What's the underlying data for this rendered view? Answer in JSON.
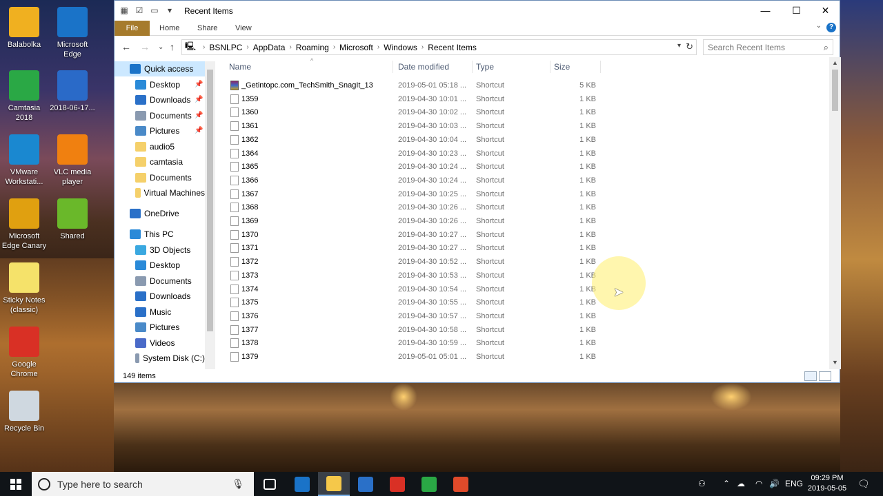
{
  "desktop": {
    "icons": [
      {
        "label": "Balabolka",
        "icon": "balabolka-icon",
        "color": "#f0b020"
      },
      {
        "label": "Microsoft Edge",
        "icon": "edge-icon",
        "color": "#1a73c8"
      },
      {
        "label": "Camtasia 2018",
        "icon": "camtasia-icon",
        "color": "#2aa845"
      },
      {
        "label": "2018-06-17...",
        "icon": "screenshot-file-icon",
        "color": "#2a6ac8"
      },
      {
        "label": "VMware Workstati...",
        "icon": "vmware-icon",
        "color": "#1a88d0"
      },
      {
        "label": "VLC media player",
        "icon": "vlc-icon",
        "color": "#f08010"
      },
      {
        "label": "Microsoft Edge Canary",
        "icon": "edge-canary-icon",
        "color": "#e0a010"
      },
      {
        "label": "Shared",
        "icon": "folder-icon",
        "color": "#6ab82a"
      },
      {
        "label": "Sticky Notes (classic)",
        "icon": "sticky-notes-icon",
        "color": "#f5e26a"
      },
      {
        "label": "Google Chrome",
        "icon": "chrome-icon",
        "color": "#d93025"
      },
      {
        "label": "Recycle Bin",
        "icon": "recycle-bin-icon",
        "color": "#cfd8e0"
      }
    ]
  },
  "window": {
    "title": "Recent Items",
    "ribbon_tabs": [
      "File",
      "Home",
      "Share",
      "View"
    ],
    "breadcrumb": [
      "BSNLPC",
      "AppData",
      "Roaming",
      "Microsoft",
      "Windows",
      "Recent Items"
    ],
    "search_placeholder": "Search Recent Items",
    "columns": [
      "Name",
      "Date modified",
      "Type",
      "Size"
    ],
    "status": "149 items",
    "nav": [
      {
        "label": "Quick access",
        "icon": "star-icon",
        "color": "#1a73c8",
        "level": 0,
        "selected": true
      },
      {
        "label": "Desktop",
        "icon": "desktop-icon",
        "color": "#2a8ad8",
        "level": 1,
        "pinned": true
      },
      {
        "label": "Downloads",
        "icon": "download-arrow-icon",
        "color": "#2a70c8",
        "level": 1,
        "pinned": true
      },
      {
        "label": "Documents",
        "icon": "documents-icon",
        "color": "#8a9ab0",
        "level": 1,
        "pinned": true
      },
      {
        "label": "Pictures",
        "icon": "pictures-icon",
        "color": "#4a8ac8",
        "level": 1,
        "pinned": true
      },
      {
        "label": "audio5",
        "icon": "folder-icon",
        "color": "#f5d06a",
        "level": 1
      },
      {
        "label": "camtasia",
        "icon": "folder-icon",
        "color": "#f5d06a",
        "level": 1
      },
      {
        "label": "Documents",
        "icon": "synced-folder-icon",
        "color": "#f5d06a",
        "level": 1
      },
      {
        "label": "Virtual Machines",
        "icon": "folder-icon",
        "color": "#f5d06a",
        "level": 1
      },
      {
        "label": "OneDrive",
        "icon": "onedrive-icon",
        "color": "#2a70c8",
        "level": 0
      },
      {
        "label": "This PC",
        "icon": "this-pc-icon",
        "color": "#2a8ad8",
        "level": 0
      },
      {
        "label": "3D Objects",
        "icon": "3d-objects-icon",
        "color": "#3aa8e0",
        "level": 1
      },
      {
        "label": "Desktop",
        "icon": "desktop-icon",
        "color": "#2a8ad8",
        "level": 1
      },
      {
        "label": "Documents",
        "icon": "documents-icon",
        "color": "#8a9ab0",
        "level": 1
      },
      {
        "label": "Downloads",
        "icon": "download-arrow-icon",
        "color": "#2a70c8",
        "level": 1
      },
      {
        "label": "Music",
        "icon": "music-icon",
        "color": "#2a70c8",
        "level": 1
      },
      {
        "label": "Pictures",
        "icon": "pictures-icon",
        "color": "#4a8ac8",
        "level": 1
      },
      {
        "label": "Videos",
        "icon": "videos-icon",
        "color": "#4a6ac8",
        "level": 1
      },
      {
        "label": "System Disk (C:)",
        "icon": "drive-icon",
        "color": "#8a9ab0",
        "level": 1
      }
    ],
    "files": [
      {
        "name": "_Getintopc.com_TechSmith_SnagIt_13",
        "date": "2019-05-01 05:18 ...",
        "type": "Shortcut",
        "size": "5 KB",
        "icon": "winrar-shortcut-icon"
      },
      {
        "name": "1359",
        "date": "2019-04-30 10:01 ...",
        "type": "Shortcut",
        "size": "1 KB",
        "icon": "blank-file-icon"
      },
      {
        "name": "1360",
        "date": "2019-04-30 10:02 ...",
        "type": "Shortcut",
        "size": "1 KB",
        "icon": "blank-file-icon"
      },
      {
        "name": "1361",
        "date": "2019-04-30 10:03 ...",
        "type": "Shortcut",
        "size": "1 KB",
        "icon": "blank-file-icon"
      },
      {
        "name": "1362",
        "date": "2019-04-30 10:04 ...",
        "type": "Shortcut",
        "size": "1 KB",
        "icon": "blank-file-icon"
      },
      {
        "name": "1364",
        "date": "2019-04-30 10:23 ...",
        "type": "Shortcut",
        "size": "1 KB",
        "icon": "blank-file-icon"
      },
      {
        "name": "1365",
        "date": "2019-04-30 10:24 ...",
        "type": "Shortcut",
        "size": "1 KB",
        "icon": "blank-file-icon"
      },
      {
        "name": "1366",
        "date": "2019-04-30 10:24 ...",
        "type": "Shortcut",
        "size": "1 KB",
        "icon": "blank-file-icon"
      },
      {
        "name": "1367",
        "date": "2019-04-30 10:25 ...",
        "type": "Shortcut",
        "size": "1 KB",
        "icon": "blank-file-icon"
      },
      {
        "name": "1368",
        "date": "2019-04-30 10:26 ...",
        "type": "Shortcut",
        "size": "1 KB",
        "icon": "blank-file-icon"
      },
      {
        "name": "1369",
        "date": "2019-04-30 10:26 ...",
        "type": "Shortcut",
        "size": "1 KB",
        "icon": "blank-file-icon"
      },
      {
        "name": "1370",
        "date": "2019-04-30 10:27 ...",
        "type": "Shortcut",
        "size": "1 KB",
        "icon": "blank-file-icon"
      },
      {
        "name": "1371",
        "date": "2019-04-30 10:27 ...",
        "type": "Shortcut",
        "size": "1 KB",
        "icon": "blank-file-icon"
      },
      {
        "name": "1372",
        "date": "2019-04-30 10:52 ...",
        "type": "Shortcut",
        "size": "1 KB",
        "icon": "blank-file-icon"
      },
      {
        "name": "1373",
        "date": "2019-04-30 10:53 ...",
        "type": "Shortcut",
        "size": "1 KB",
        "icon": "blank-file-icon"
      },
      {
        "name": "1374",
        "date": "2019-04-30 10:54 ...",
        "type": "Shortcut",
        "size": "1 KB",
        "icon": "blank-file-icon"
      },
      {
        "name": "1375",
        "date": "2019-04-30 10:55 ...",
        "type": "Shortcut",
        "size": "1 KB",
        "icon": "blank-file-icon"
      },
      {
        "name": "1376",
        "date": "2019-04-30 10:57 ...",
        "type": "Shortcut",
        "size": "1 KB",
        "icon": "blank-file-icon"
      },
      {
        "name": "1377",
        "date": "2019-04-30 10:58 ...",
        "type": "Shortcut",
        "size": "1 KB",
        "icon": "blank-file-icon"
      },
      {
        "name": "1378",
        "date": "2019-04-30 10:59 ...",
        "type": "Shortcut",
        "size": "1 KB",
        "icon": "blank-file-icon"
      },
      {
        "name": "1379",
        "date": "2019-05-01 05:01 ...",
        "type": "Shortcut",
        "size": "1 KB",
        "icon": "blank-file-icon"
      }
    ]
  },
  "taskbar": {
    "search_placeholder": "Type here to search",
    "apps": [
      {
        "icon": "task-view-icon",
        "color": "#ffffff"
      },
      {
        "icon": "edge-icon",
        "color": "#1a73c8"
      },
      {
        "icon": "file-explorer-icon",
        "color": "#f5c84a",
        "active": true
      },
      {
        "icon": "store-icon",
        "color": "#2a70c8"
      },
      {
        "icon": "chrome-icon",
        "color": "#d93025"
      },
      {
        "icon": "camtasia-icon",
        "color": "#2aa845"
      },
      {
        "icon": "snagit-icon",
        "color": "#e04a2a"
      }
    ],
    "language": "ENG",
    "time": "09:29 PM",
    "date": "2019-05-05"
  }
}
